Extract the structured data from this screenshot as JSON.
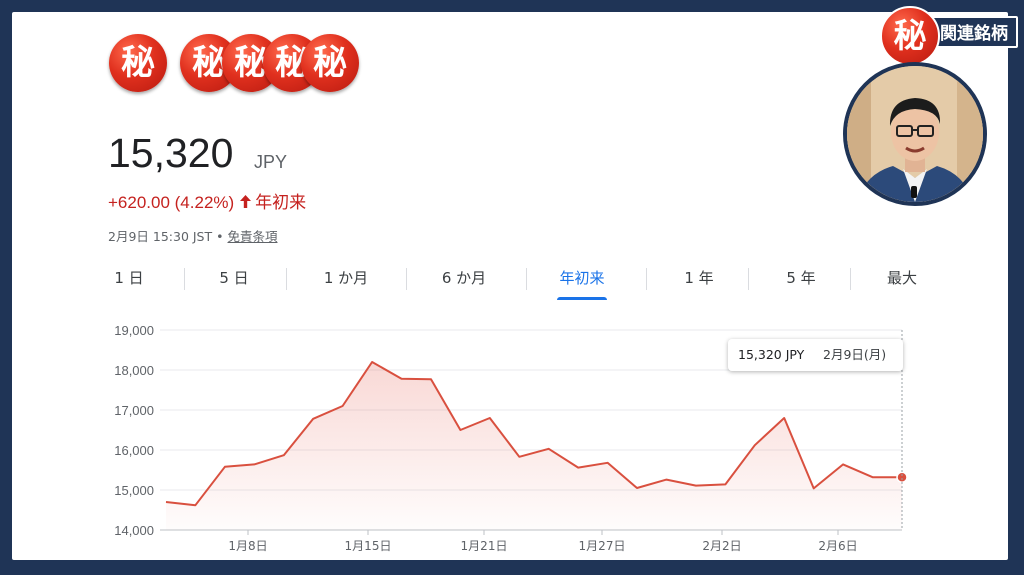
{
  "stamps": {
    "glyph": "秘",
    "count": 5
  },
  "badge": {
    "glyph": "秘",
    "text": "関連銘柄"
  },
  "quote": {
    "price": "15,320",
    "currency": "JPY",
    "change": "+620.00 (4.22%)",
    "period": "年初来",
    "timestamp": "2月9日 15:30 JST",
    "separator": "•",
    "disclaimer": "免責条項"
  },
  "tabs": [
    {
      "label": "1 日",
      "active": false
    },
    {
      "label": "5 日",
      "active": false
    },
    {
      "label": "1 か月",
      "active": false
    },
    {
      "label": "6 か月",
      "active": false
    },
    {
      "label": "年初来",
      "active": true
    },
    {
      "label": "1 年",
      "active": false
    },
    {
      "label": "5 年",
      "active": false
    },
    {
      "label": "最大",
      "active": false
    }
  ],
  "tooltip": {
    "price": "15,320 JPY",
    "date": "2月9日(月)"
  },
  "colors": {
    "line": "#d9503f",
    "accent": "#1a73e8",
    "negative_change": "#c5221f",
    "frame": "#1f3456",
    "stamp": "#e0301e"
  },
  "chart_data": {
    "type": "area",
    "yticks": [
      "19,000",
      "18,000",
      "17,000",
      "16,000",
      "15,000",
      "14,000"
    ],
    "ylim": [
      14000,
      19000
    ],
    "xticks": [
      "1月8日",
      "1月15日",
      "1月21日",
      "1月27日",
      "2月2日",
      "2月6日"
    ],
    "grid": true,
    "series": [
      {
        "values": [
          14700,
          14620,
          15580,
          15640,
          15870,
          16780,
          17100,
          18200,
          17780,
          17770,
          16500,
          16800,
          15830,
          16030,
          15560,
          15680,
          15050,
          15260,
          15110,
          15140,
          16120,
          16800,
          15040,
          15640,
          15320,
          15320
        ]
      }
    ]
  }
}
